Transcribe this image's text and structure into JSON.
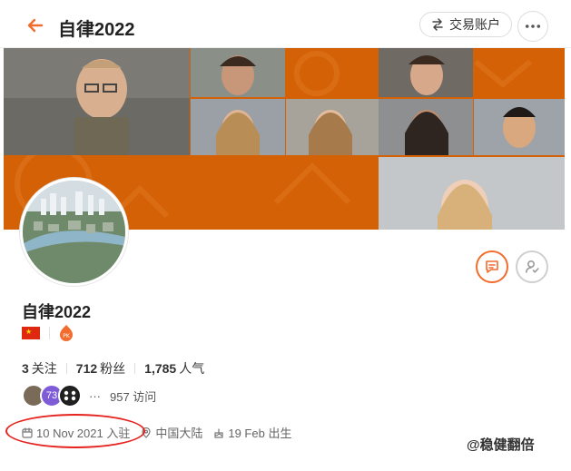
{
  "header": {
    "title": "自律2022",
    "trade_button_label": "交易账户"
  },
  "profile": {
    "name": "自律2022",
    "badge_pk": "PK",
    "stats": [
      {
        "value": "3",
        "label": "关注"
      },
      {
        "value": "712",
        "label": "粉丝"
      },
      {
        "value": "1,785",
        "label": "人气"
      }
    ],
    "visitor_count_text": "957 访问",
    "visitor_more": "···",
    "visitor_avatar_2_label": "73",
    "joined": "10 Nov 2021 入驻",
    "location": "中国大陆",
    "birthday": "19 Feb 出生"
  },
  "colors": {
    "accent": "#F26C2E",
    "banner_orange": "#D46106",
    "annotation_red": "#E52420"
  },
  "watermark": "@稳健翻倍"
}
